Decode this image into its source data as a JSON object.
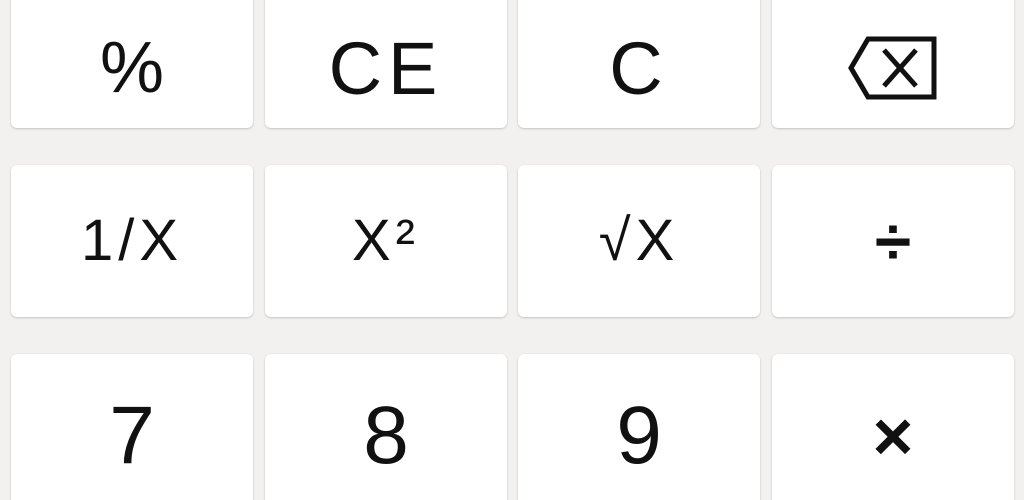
{
  "keypad": {
    "rows": [
      [
        {
          "name": "percent-button",
          "label": "%"
        },
        {
          "name": "clear-entry-button",
          "label": "CE"
        },
        {
          "name": "clear-button",
          "label": "C"
        },
        {
          "name": "backspace-button",
          "icon": "backspace-icon"
        }
      ],
      [
        {
          "name": "reciprocal-button",
          "label": "1/X"
        },
        {
          "name": "square-button",
          "label": "X²"
        },
        {
          "name": "square-root-button",
          "label": "√X"
        },
        {
          "name": "divide-button",
          "label": "÷"
        }
      ],
      [
        {
          "name": "digit-7-button",
          "label": "7"
        },
        {
          "name": "digit-8-button",
          "label": "8"
        },
        {
          "name": "digit-9-button",
          "label": "9"
        },
        {
          "name": "multiply-button",
          "label": "×"
        }
      ]
    ]
  },
  "theme": {
    "background": "#f2f1ef",
    "key_background": "#ffffff",
    "text_color": "#111111"
  }
}
